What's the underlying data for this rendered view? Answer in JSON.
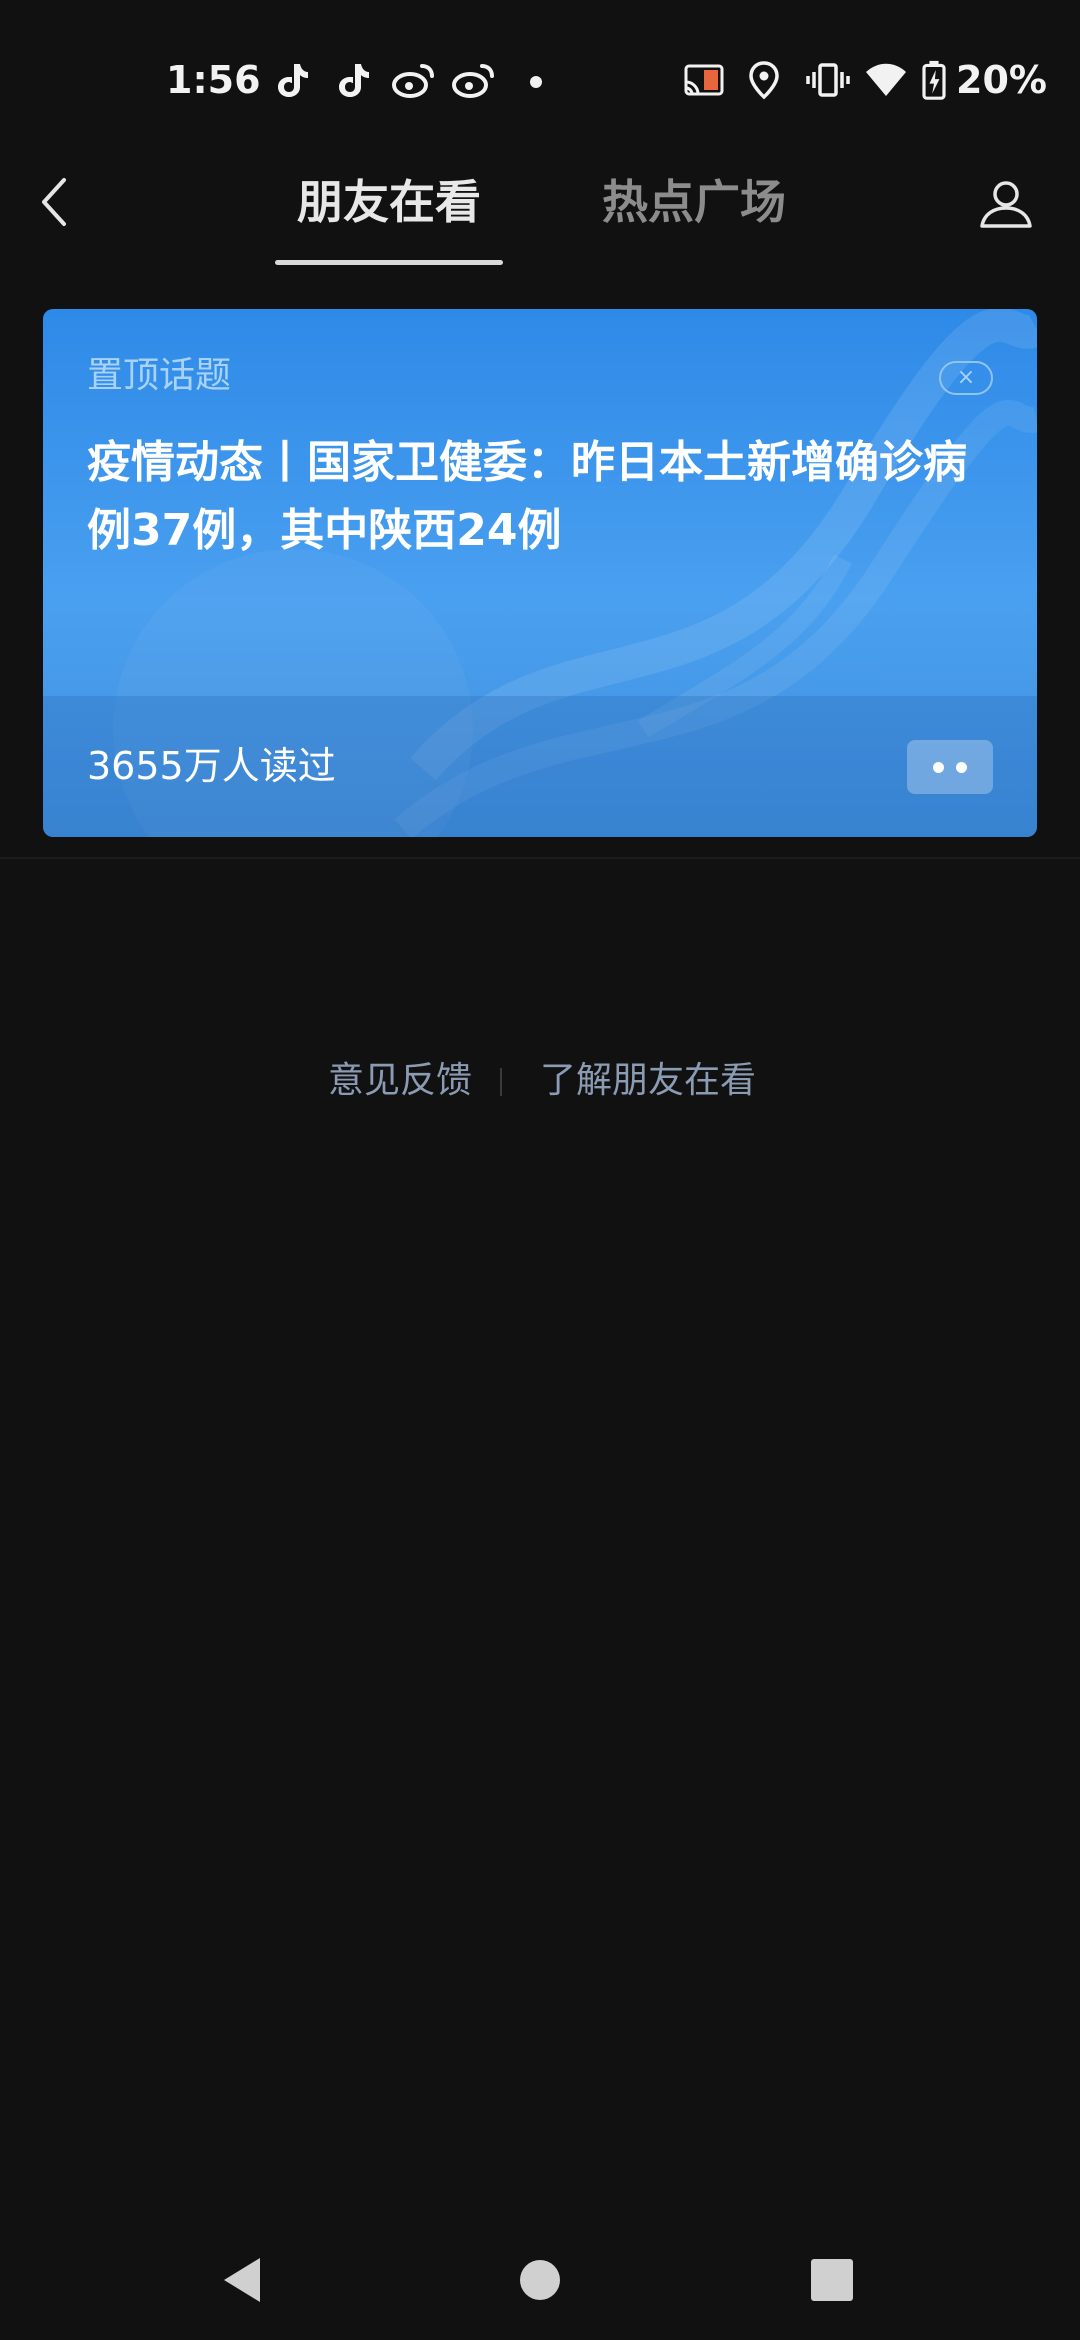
{
  "status_bar": {
    "time": "1:56",
    "battery": "20%",
    "icons": [
      "tiktok-icon",
      "tiktok-icon",
      "weibo-icon",
      "weibo-icon",
      "dot-icon",
      "cast-icon",
      "location-icon",
      "vibrate-icon",
      "wifi-icon",
      "battery-charging-icon"
    ]
  },
  "header": {
    "back_icon": "chevron-left-icon",
    "tabs": [
      {
        "label": "朋友在看",
        "active": true
      },
      {
        "label": "热点广场",
        "active": false
      }
    ],
    "profile_icon": "person-icon"
  },
  "pinned_card": {
    "tag": "置顶话题",
    "close_label": "×",
    "title": "疫情动态丨国家卫健委：昨日本土新增确诊病例37例，其中陕西24例",
    "reads": "3655万人读过",
    "more_icon": "more-dots-icon"
  },
  "links": {
    "feedback": "意见反馈",
    "about": "了解朋友在看"
  },
  "colors": {
    "background": "#111111",
    "card_blue": "#3a95ec",
    "link_text": "#8a9bb3",
    "active_tab": "#e8e8e8",
    "inactive_tab": "#8c8c8c"
  },
  "navbar": {
    "icons": [
      "back-triangle-icon",
      "home-circle-icon",
      "recents-square-icon"
    ]
  }
}
